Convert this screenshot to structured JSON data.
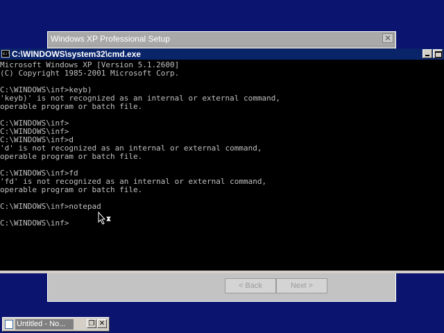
{
  "setup_window": {
    "title": "Windows XP Professional Setup",
    "close_glyph": "✕",
    "back_label": "< Back",
    "next_label": "Next >"
  },
  "cmd_window": {
    "title": "C:\\WINDOWS\\system32\\cmd.exe",
    "icon_glyph": "c:\\",
    "output": "Microsoft Windows XP [Version 5.1.2600]\n(C) Copyright 1985-2001 Microsoft Corp.\n\nC:\\WINDOWS\\inf>keyb)\n'keyb)' is not recognized as an internal or external command,\noperable program or batch file.\n\nC:\\WINDOWS\\inf>\nC:\\WINDOWS\\inf>\nC:\\WINDOWS\\inf>d\n'd' is not recognized as an internal or external command,\noperable program or batch file.\n\nC:\\WINDOWS\\inf>fd\n'fd' is not recognized as an internal or external command,\noperable program or batch file.\n\nC:\\WINDOWS\\inf>notepad\n\nC:\\WINDOWS\\inf>"
  },
  "taskbar": {
    "item_label": "Untitled - No...",
    "restore_glyph": "❐",
    "close_glyph": "✕"
  },
  "colors": {
    "desktop": "#0b1570",
    "console_bg": "#000000",
    "console_fg": "#c0c0c0",
    "titlebar_active": "#0a246a"
  }
}
